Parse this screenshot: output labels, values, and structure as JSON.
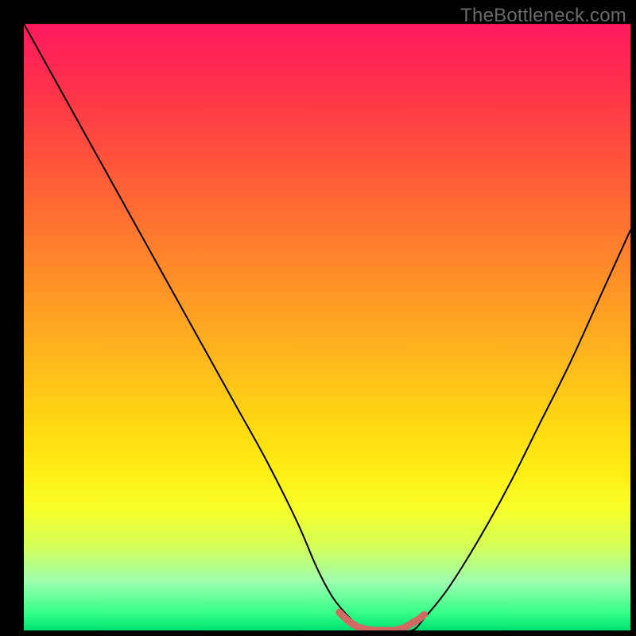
{
  "watermark": "TheBottleneck.com",
  "chart_data": {
    "type": "line",
    "title": "",
    "xlabel": "",
    "ylabel": "",
    "xlim": [
      0,
      100
    ],
    "ylim": [
      0,
      100
    ],
    "series": [
      {
        "name": "bottleneck-curve",
        "x": [
          0,
          5,
          10,
          15,
          20,
          25,
          30,
          35,
          40,
          45,
          48,
          50,
          52,
          55,
          58,
          61,
          64,
          66,
          70,
          75,
          80,
          85,
          90,
          95,
          100
        ],
        "values": [
          100,
          91,
          82,
          73,
          64,
          55,
          46,
          37,
          28,
          18,
          11,
          7,
          4,
          1,
          0,
          0,
          0,
          2,
          7,
          15,
          24,
          34,
          44,
          55,
          66
        ]
      },
      {
        "name": "valley-highlight",
        "color": "#d06a63",
        "x": [
          52,
          53,
          54,
          55,
          56,
          57,
          58,
          59,
          60,
          61,
          62,
          63,
          64,
          65,
          66
        ],
        "values": [
          3,
          2,
          1.2,
          0.6,
          0.3,
          0.1,
          0,
          0,
          0,
          0,
          0.2,
          0.6,
          1.2,
          1.8,
          2.6
        ]
      }
    ],
    "gradient_stops": [
      {
        "pct": 0,
        "color": "#ff1a5e"
      },
      {
        "pct": 8,
        "color": "#ff2b50"
      },
      {
        "pct": 18,
        "color": "#ff4640"
      },
      {
        "pct": 30,
        "color": "#ff6a33"
      },
      {
        "pct": 42,
        "color": "#ff8f28"
      },
      {
        "pct": 54,
        "color": "#ffb41e"
      },
      {
        "pct": 66,
        "color": "#ffd812"
      },
      {
        "pct": 74,
        "color": "#ffee14"
      },
      {
        "pct": 80,
        "color": "#f7ff2a"
      },
      {
        "pct": 86,
        "color": "#d5ff55"
      },
      {
        "pct": 92,
        "color": "#9cffb0"
      },
      {
        "pct": 97,
        "color": "#37ff88"
      },
      {
        "pct": 100,
        "color": "#00e072"
      }
    ]
  }
}
